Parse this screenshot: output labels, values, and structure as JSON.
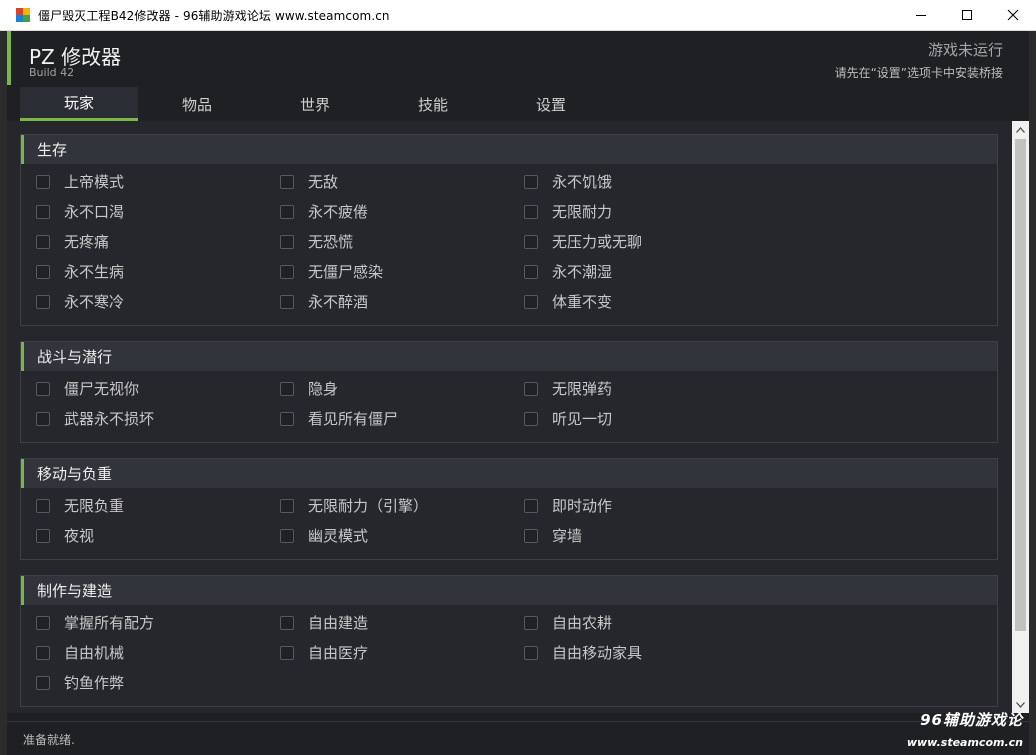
{
  "window": {
    "title": "僵尸毁灭工程B42修改器 - 96辅助游戏论坛 www.steamcom.cn"
  },
  "header": {
    "app_title": "PZ 修改器",
    "build": "Build 42",
    "status": "游戏未运行",
    "status_hint": "请先在“设置”选项卡中安装桥接"
  },
  "tabs": [
    {
      "label": "玩家",
      "active": true
    },
    {
      "label": "物品",
      "active": false
    },
    {
      "label": "世界",
      "active": false
    },
    {
      "label": "技能",
      "active": false
    },
    {
      "label": "设置",
      "active": false
    }
  ],
  "sections": [
    {
      "title": "生存",
      "items": [
        "上帝模式",
        "无敌",
        "永不饥饿",
        "永不口渴",
        "永不疲倦",
        "无限耐力",
        "无疼痛",
        "无恐慌",
        "无压力或无聊",
        "永不生病",
        "无僵尸感染",
        "永不潮湿",
        "永不寒冷",
        "永不醉酒",
        "体重不变"
      ]
    },
    {
      "title": "战斗与潜行",
      "items": [
        "僵尸无视你",
        "隐身",
        "无限弹药",
        "武器永不损坏",
        "看见所有僵尸",
        "听见一切"
      ]
    },
    {
      "title": "移动与负重",
      "items": [
        "无限负重",
        "无限耐力（引擎）",
        "即时动作",
        "夜视",
        "幽灵模式",
        "穿墙"
      ]
    },
    {
      "title": "制作与建造",
      "items": [
        "掌握所有配方",
        "自由建造",
        "自由农耕",
        "自由机械",
        "自由医疗",
        "自由移动家具",
        "钓鱼作弊"
      ]
    }
  ],
  "footer": {
    "status": "准备就绪.",
    "watermark_line1": "96辅助游戏论",
    "watermark_line2": "www.steamcom.cn"
  },
  "colors": {
    "accent": "#7ab648",
    "background": "#1e2024",
    "panel": "#25272c"
  }
}
